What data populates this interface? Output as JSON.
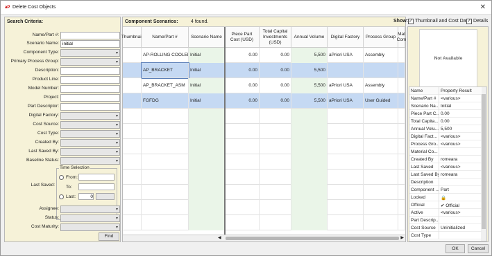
{
  "window": {
    "title": "Delete Cost Objects",
    "app_icon": "aP",
    "close": "✕"
  },
  "search": {
    "title": "Search Criteria:",
    "fields": [
      {
        "label": "Name/Part #:",
        "value": "",
        "type": "text"
      },
      {
        "label": "Scenario Name:",
        "value": "initial",
        "type": "text"
      },
      {
        "label": "Component Type:",
        "value": "",
        "type": "select"
      },
      {
        "label": "Primary Process Group:",
        "value": "",
        "type": "select"
      },
      {
        "label": "Description:",
        "value": "",
        "type": "text"
      },
      {
        "label": "Product Line:",
        "value": "",
        "type": "text"
      },
      {
        "label": "Model Number:",
        "value": "",
        "type": "text"
      },
      {
        "label": "Project:",
        "value": "",
        "type": "text"
      },
      {
        "label": "Part Descriptor:",
        "value": "",
        "type": "text"
      },
      {
        "label": "Digital Factory:",
        "value": "",
        "type": "select"
      },
      {
        "label": "Cost Source:",
        "value": "",
        "type": "select"
      },
      {
        "label": "Cost Type:",
        "value": "",
        "type": "select"
      },
      {
        "label": "Created By:",
        "value": "",
        "type": "select"
      },
      {
        "label": "Last Saved By:",
        "value": "",
        "type": "select"
      },
      {
        "label": "Baseline Status:",
        "value": "",
        "type": "select"
      }
    ],
    "last_saved_label": "Last Saved:",
    "time_selection": {
      "legend": "Time Selection",
      "from": "From:",
      "to": "To:",
      "last": "Last:",
      "last_value": "0"
    },
    "fields_bottom": [
      {
        "label": "Assignee:",
        "value": ""
      },
      {
        "label": "Status:",
        "value": ""
      },
      {
        "label": "Cost Maturity:",
        "value": ""
      }
    ],
    "find_label": "Find"
  },
  "scenarios": {
    "title": "Component Scenarios:",
    "count": "4 found.",
    "columns": [
      "Thumbnail",
      "Name/Part #",
      "Scenario Name",
      "Piece Part Cost (USD)",
      "Total Capital Investments (USD)",
      "Annual Volume",
      "Digital Factory",
      "Process Group",
      "Mat Com"
    ],
    "rows": [
      {
        "name": "AP-ROLLING COOLER",
        "scenario": "Initial",
        "ppc": "0.00",
        "tci": "0.00",
        "vol": "5,500",
        "factory": "aPriori USA",
        "process": "Assembly",
        "selected": false
      },
      {
        "name": "AP_BRACKET",
        "scenario": "Initial",
        "ppc": "0.00",
        "tci": "0.00",
        "vol": "5,500",
        "factory": "",
        "process": "",
        "selected": true
      },
      {
        "name": "AP_BRACKET_ASM",
        "scenario": "Initial",
        "ppc": "0.00",
        "tci": "0.00",
        "vol": "5,500",
        "factory": "aPriori USA",
        "process": "Assembly",
        "selected": false
      },
      {
        "name": "FGFDG",
        "scenario": "Initial",
        "ppc": "0.00",
        "tci": "0.00",
        "vol": "5,500",
        "factory": "aPriori USA",
        "process": "User Guided",
        "selected": true
      }
    ]
  },
  "show": {
    "label": "Show:",
    "thumb_cost": "Thumbnail and Cost Data",
    "details": "Details"
  },
  "thumbnail": {
    "text": "Not Available"
  },
  "properties": {
    "headers": [
      "Name",
      "Property Result"
    ],
    "rows": [
      [
        "Name/Part #",
        "<various>"
      ],
      [
        "Scenario Na...",
        "Initial"
      ],
      [
        "Piece Part C...",
        "0.00"
      ],
      [
        "Total Capita...",
        "0.00"
      ],
      [
        "Annual Volu...",
        "5,500"
      ],
      [
        "Digital Fact...",
        "<various>"
      ],
      [
        "Process Gro...",
        "<various>"
      ],
      [
        "Material Co...",
        ""
      ],
      [
        "Created By",
        "romeara"
      ],
      [
        "Last Saved",
        "<various>"
      ],
      [
        "Last Saved By",
        "romeara"
      ],
      [
        "Description",
        ""
      ],
      [
        "Component ...",
        "Part"
      ],
      [
        "Locked",
        "🔒"
      ],
      [
        "Official",
        "✔ Official"
      ],
      [
        "Active",
        "<various>"
      ],
      [
        "Part Descrip...",
        ""
      ],
      [
        "Cost Source",
        "Uninitialized"
      ],
      [
        "Cost Type",
        ""
      ]
    ]
  },
  "footer": {
    "ok": "OK",
    "cancel": "Cancel"
  }
}
